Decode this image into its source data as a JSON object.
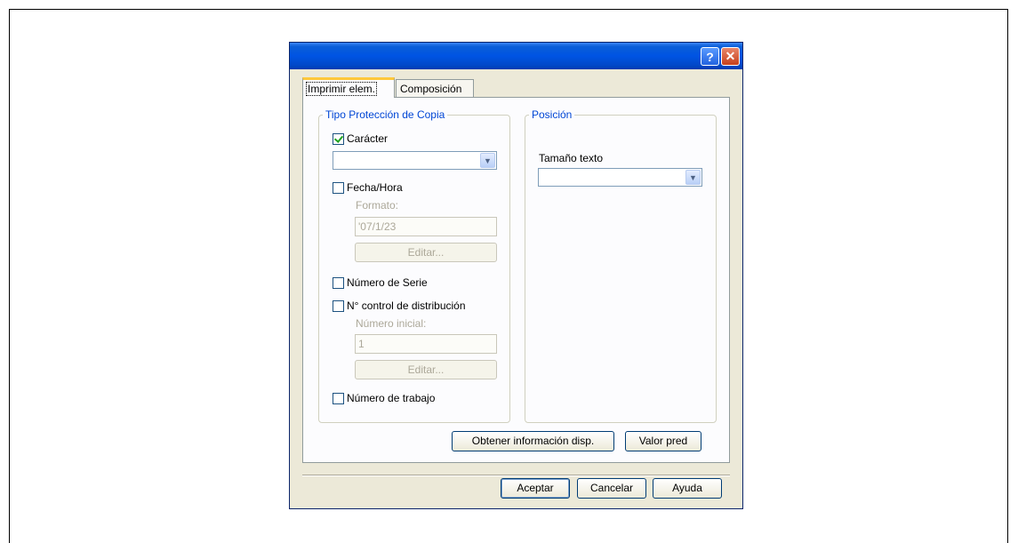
{
  "tabs": [
    {
      "label": "Imprimir elem."
    },
    {
      "label": "Composición"
    }
  ],
  "group_protection": {
    "title": "Tipo Protección de Copia",
    "character": {
      "label": "Carácter",
      "checked": true,
      "value": ""
    },
    "datetime": {
      "label": "Fecha/Hora",
      "checked": false,
      "format_label": "Formato:",
      "format_value": "'07/1/23",
      "edit_label": "Editar..."
    },
    "serial": {
      "label": "Número de Serie",
      "checked": false
    },
    "distribution": {
      "label": "N° control de distribución",
      "checked": false,
      "start_label": "Número inicial:",
      "start_value": "1",
      "edit_label": "Editar..."
    },
    "job": {
      "label": "Número de trabajo",
      "checked": false
    }
  },
  "group_position": {
    "title": "Posición",
    "text_size_label": "Tamaño texto",
    "text_size_value": ""
  },
  "buttons": {
    "get_info": "Obtener información disp.",
    "default": "Valor pred",
    "ok": "Aceptar",
    "cancel": "Cancelar",
    "help": "Ayuda"
  },
  "titlebar": {
    "help_glyph": "?",
    "close_glyph": "✕"
  }
}
